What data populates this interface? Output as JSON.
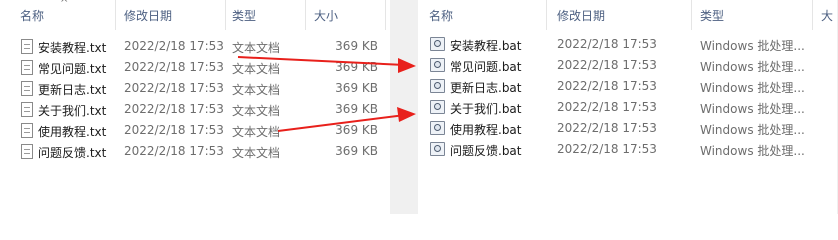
{
  "left_pane": {
    "columns": [
      "名称",
      "修改日期",
      "类型",
      "大小"
    ],
    "rows": [
      {
        "name": "安装教程.txt",
        "date": "2022/2/18 17:53",
        "type": "文本文档",
        "size": "369 KB"
      },
      {
        "name": "常见问题.txt",
        "date": "2022/2/18 17:53",
        "type": "文本文档",
        "size": "369 KB"
      },
      {
        "name": "更新日志.txt",
        "date": "2022/2/18 17:53",
        "type": "文本文档",
        "size": "369 KB"
      },
      {
        "name": "关于我们.txt",
        "date": "2022/2/18 17:53",
        "type": "文本文档",
        "size": "369 KB"
      },
      {
        "name": "使用教程.txt",
        "date": "2022/2/18 17:53",
        "type": "文本文档",
        "size": "369 KB"
      },
      {
        "name": "问题反馈.txt",
        "date": "2022/2/18 17:53",
        "type": "文本文档",
        "size": "369 KB"
      }
    ]
  },
  "right_pane": {
    "columns": [
      "名称",
      "修改日期",
      "类型",
      "大"
    ],
    "rows": [
      {
        "name": "安装教程.bat",
        "date": "2022/2/18 17:53",
        "type": "Windows 批处理..."
      },
      {
        "name": "常见问题.bat",
        "date": "2022/2/18 17:53",
        "type": "Windows 批处理..."
      },
      {
        "name": "更新日志.bat",
        "date": "2022/2/18 17:53",
        "type": "Windows 批处理..."
      },
      {
        "name": "关于我们.bat",
        "date": "2022/2/18 17:53",
        "type": "Windows 批处理..."
      },
      {
        "name": "使用教程.bat",
        "date": "2022/2/18 17:53",
        "type": "Windows 批处理..."
      },
      {
        "name": "问题反馈.bat",
        "date": "2022/2/18 17:53",
        "type": "Windows 批处理..."
      }
    ]
  },
  "icons": {
    "txt": "text-file-icon",
    "bat": "batch-file-icon",
    "arrow": "red-arrow-annotation"
  },
  "colors": {
    "header_text": "#4d6082",
    "arrow": "#e8201b",
    "muted_text": "#6d6d6d"
  }
}
